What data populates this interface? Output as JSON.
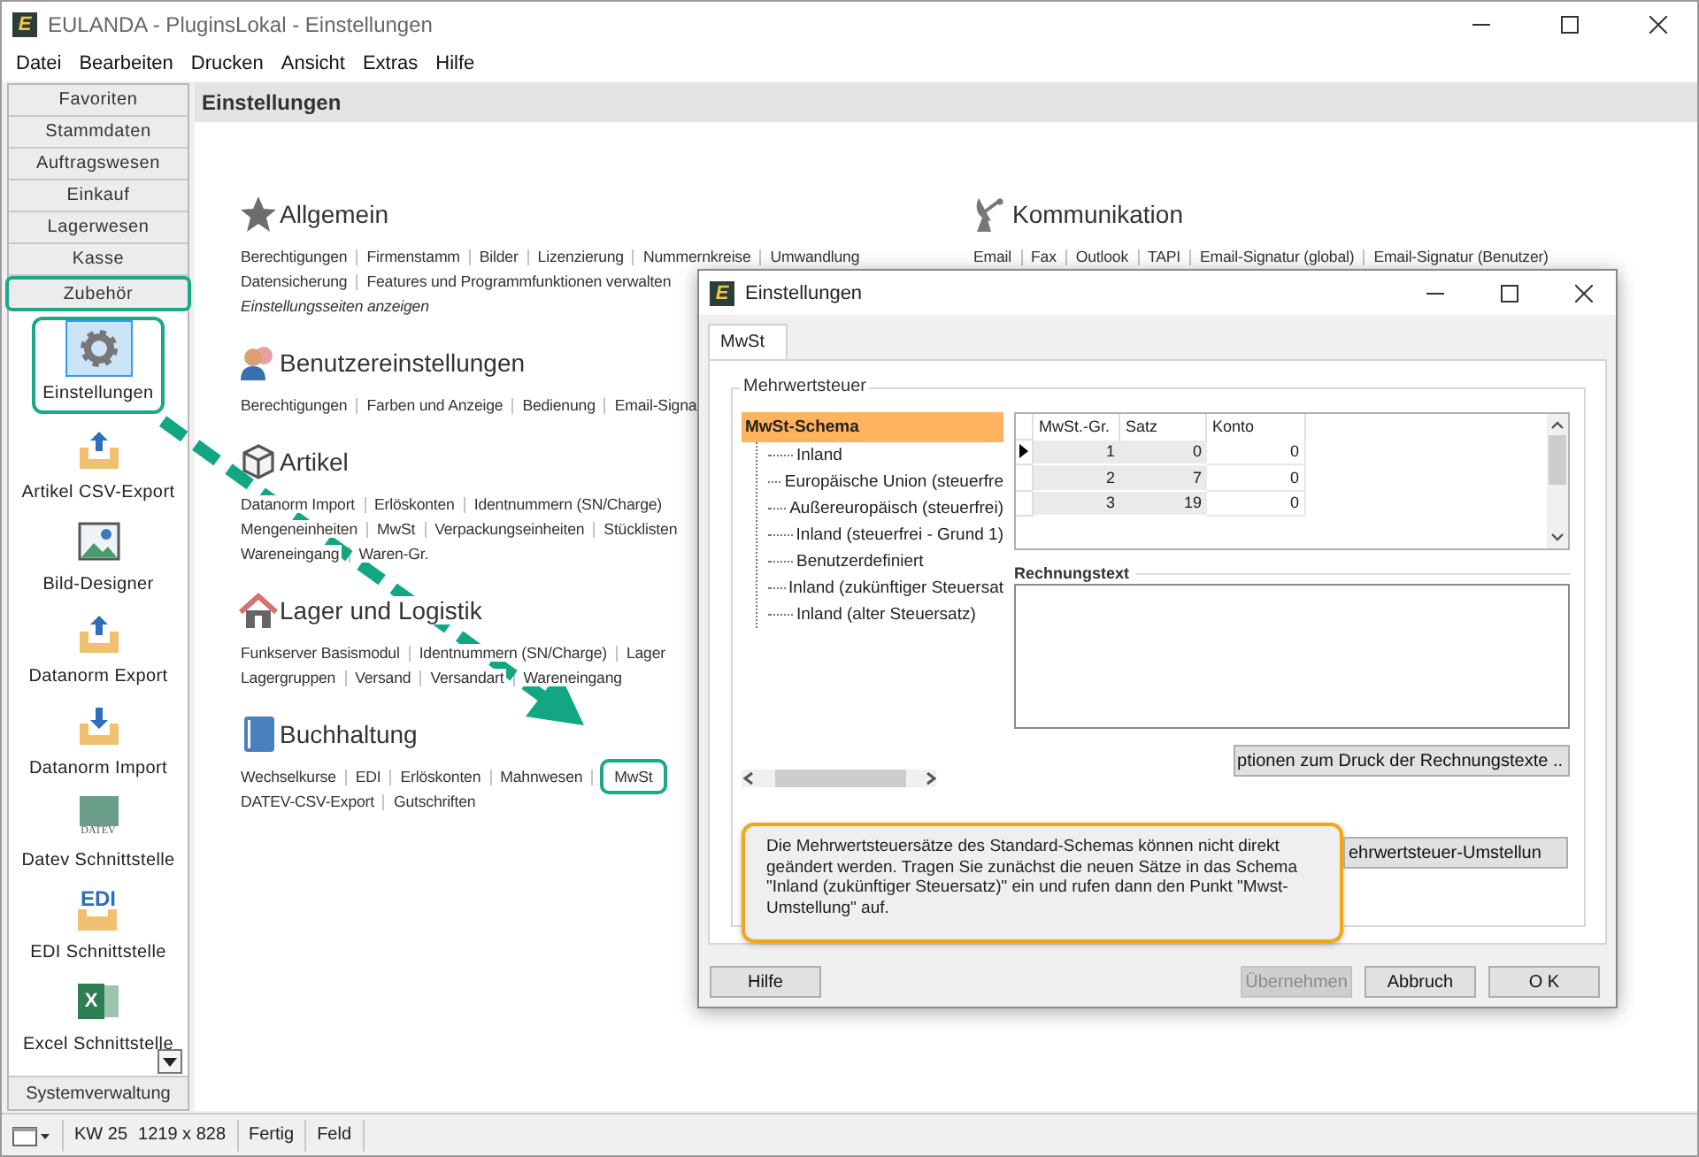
{
  "window": {
    "logo": "E",
    "title": "EULANDA - PluginsLokal - Einstellungen"
  },
  "menu": [
    "Datei",
    "Bearbeiten",
    "Drucken",
    "Ansicht",
    "Extras",
    "Hilfe"
  ],
  "sidebar": {
    "groups": [
      {
        "label": "Favoriten",
        "highlighted": false
      },
      {
        "label": "Stammdaten",
        "highlighted": false
      },
      {
        "label": "Auftragswesen",
        "highlighted": false
      },
      {
        "label": "Einkauf",
        "highlighted": false
      },
      {
        "label": "Lagerwesen",
        "highlighted": false
      },
      {
        "label": "Kasse",
        "highlighted": false
      },
      {
        "label": "Zubehör",
        "highlighted": true
      }
    ],
    "items": [
      {
        "label": "Einstellungen",
        "kind": "gear",
        "selected": true,
        "highlighted": true
      },
      {
        "label": "Artikel CSV-Export",
        "kind": "upload",
        "selected": false,
        "highlighted": false
      },
      {
        "label": "Bild-Designer",
        "kind": "image",
        "selected": false,
        "highlighted": false
      },
      {
        "label": "Datanorm Export",
        "kind": "upload",
        "selected": false,
        "highlighted": false
      },
      {
        "label": "Datanorm Import",
        "kind": "download",
        "selected": false,
        "highlighted": false
      },
      {
        "label": "Datev Schnittstelle",
        "kind": "datev",
        "icon_text": "DATEV",
        "selected": false,
        "highlighted": false
      },
      {
        "label": "EDI Schnittstelle",
        "kind": "edi",
        "icon_text": "EDI",
        "selected": false,
        "highlighted": false
      },
      {
        "label": "Excel Schnittstelle",
        "kind": "excel",
        "icon_text": "X",
        "selected": false,
        "highlighted": false
      }
    ],
    "footer_group": "Systemverwaltung"
  },
  "content": {
    "title": "Einstellungen",
    "columns": [
      [
        {
          "heading": "Allgemein",
          "kind": "star",
          "lines": [
            {
              "italic": false,
              "links": [
                {
                  "label": "Berechtigungen",
                  "highlighted": false
                },
                {
                  "label": "Firmenstamm",
                  "highlighted": false
                },
                {
                  "label": "Bilder",
                  "highlighted": false
                },
                {
                  "label": "Lizenzierung",
                  "highlighted": false
                },
                {
                  "label": "Nummernkreise",
                  "highlighted": false
                },
                {
                  "label": "Umwandlung",
                  "highlighted": false
                }
              ]
            },
            {
              "italic": false,
              "links": [
                {
                  "label": "Datensicherung",
                  "highlighted": false
                },
                {
                  "label": "Features und Programmfunktionen verwalten",
                  "highlighted": false
                }
              ]
            },
            {
              "italic": true,
              "links": [
                {
                  "label": "Einstellungsseiten anzeigen",
                  "highlighted": false
                }
              ]
            }
          ]
        },
        {
          "heading": "Benutzereinstellungen",
          "kind": "users",
          "lines": [
            {
              "italic": false,
              "links": [
                {
                  "label": "Berechtigungen",
                  "highlighted": false
                },
                {
                  "label": "Farben und Anzeige",
                  "highlighted": false
                },
                {
                  "label": "Bedienung",
                  "highlighted": false
                },
                {
                  "label": "Email-Signa",
                  "highlighted": false
                }
              ]
            }
          ]
        },
        {
          "heading": "Artikel",
          "kind": "cube",
          "lines": [
            {
              "italic": false,
              "links": [
                {
                  "label": "Datanorm Import",
                  "highlighted": false
                },
                {
                  "label": "Erlöskonten",
                  "highlighted": false
                },
                {
                  "label": "Identnummern (SN/Charge)",
                  "highlighted": false
                }
              ]
            },
            {
              "italic": false,
              "links": [
                {
                  "label": "Mengeneinheiten",
                  "highlighted": false
                },
                {
                  "label": "MwSt",
                  "highlighted": false
                },
                {
                  "label": "Verpackungseinheiten",
                  "highlighted": false
                },
                {
                  "label": "Stücklisten",
                  "highlighted": false
                }
              ]
            },
            {
              "italic": false,
              "links": [
                {
                  "label": "Wareneingang",
                  "highlighted": false
                },
                {
                  "label": "Waren-Gr.",
                  "highlighted": false
                }
              ]
            }
          ]
        },
        {
          "heading": "Lager und Logistik",
          "kind": "house",
          "lines": [
            {
              "italic": false,
              "links": [
                {
                  "label": "Funkserver Basismodul",
                  "highlighted": false
                },
                {
                  "label": "Identnummern (SN/Charge)",
                  "highlighted": false
                },
                {
                  "label": "Lager",
                  "highlighted": false
                }
              ]
            },
            {
              "italic": false,
              "links": [
                {
                  "label": "Lagergruppen",
                  "highlighted": false
                },
                {
                  "label": "Versand",
                  "highlighted": false
                },
                {
                  "label": "Versandart",
                  "highlighted": false
                },
                {
                  "label": "Wareneingang",
                  "highlighted": false
                }
              ]
            }
          ]
        },
        {
          "heading": "Buchhaltung",
          "kind": "book",
          "lines": [
            {
              "italic": false,
              "links": [
                {
                  "label": "Wechselkurse",
                  "highlighted": false
                },
                {
                  "label": "EDI",
                  "highlighted": false
                },
                {
                  "label": "Erlöskonten",
                  "highlighted": false
                },
                {
                  "label": "Mahnwesen",
                  "highlighted": false
                },
                {
                  "label": "MwSt",
                  "highlighted": true
                }
              ]
            },
            {
              "italic": false,
              "links": [
                {
                  "label": "DATEV-CSV-Export",
                  "highlighted": false
                },
                {
                  "label": "Gutschriften",
                  "highlighted": false
                }
              ]
            }
          ]
        }
      ],
      [
        {
          "heading": "Kommunikation",
          "kind": "dish",
          "lines": [
            {
              "italic": false,
              "links": [
                {
                  "label": "Email",
                  "highlighted": false
                },
                {
                  "label": "Fax",
                  "highlighted": false
                },
                {
                  "label": "Outlook",
                  "highlighted": false
                },
                {
                  "label": "TAPI",
                  "highlighted": false
                },
                {
                  "label": "Email-Signatur (global)",
                  "highlighted": false
                },
                {
                  "label": "Email-Signatur (Benutzer)",
                  "highlighted": false
                }
              ]
            }
          ]
        }
      ]
    ]
  },
  "status_bar": [
    {
      "texts": [
        "KW 25",
        "1219 x 828"
      ]
    },
    {
      "texts": [
        "Fertig"
      ]
    },
    {
      "texts": [
        "Feld"
      ]
    }
  ],
  "dialog": {
    "logo": "E",
    "title": "Einstellungen",
    "tabs": [
      {
        "label": "MwSt",
        "selected": true
      }
    ],
    "group": "Mehrwertsteuer",
    "tree": {
      "label": "MwSt-Schema",
      "selected": true,
      "children": [
        {
          "label": "Inland",
          "selected": false
        },
        {
          "label": "Europäische Union (steuerfre",
          "selected": false
        },
        {
          "label": "Außereuropäisch (steuerfrei)",
          "selected": false
        },
        {
          "label": "Inland (steuerfrei - Grund 1)",
          "selected": false
        },
        {
          "label": "Benutzerdefiniert",
          "selected": false
        },
        {
          "label": "Inland (zukünftiger Steuersat",
          "selected": false
        },
        {
          "label": "Inland (alter Steuersatz)",
          "selected": false
        }
      ]
    },
    "grid": {
      "columns": [
        "MwSt.-Gr.",
        "Satz",
        "Konto"
      ],
      "rows": [
        {
          "current": true,
          "cells": [
            "1",
            "0",
            "0"
          ]
        },
        {
          "current": false,
          "cells": [
            "2",
            "7",
            "0"
          ]
        },
        {
          "current": false,
          "cells": [
            "3",
            "19",
            "0"
          ]
        }
      ]
    },
    "invoice_text_label": "Rechnungstext",
    "options_button": "ptionen zum Druck der Rechnungstexte ..",
    "changeover_button": "ehrwertsteuer-Umstellun",
    "note": {
      "text": "Die Mehrwertsteuersätze des Standard-Schemas können nicht direkt geändert werden. Tragen Sie zunächst die neuen Sätze in das Schema \"Inland (zukünftiger Steuersatz)\" ein und rufen dann den Punkt \"Mwst-Umstellung\" auf.",
      "highlighted": true
    },
    "buttons": [
      {
        "label": "Hilfe",
        "disabled": false
      },
      {
        "label": "Übernehmen",
        "disabled": true
      },
      {
        "label": "Abbruch",
        "disabled": false
      },
      {
        "label": "O K",
        "disabled": false
      }
    ]
  }
}
